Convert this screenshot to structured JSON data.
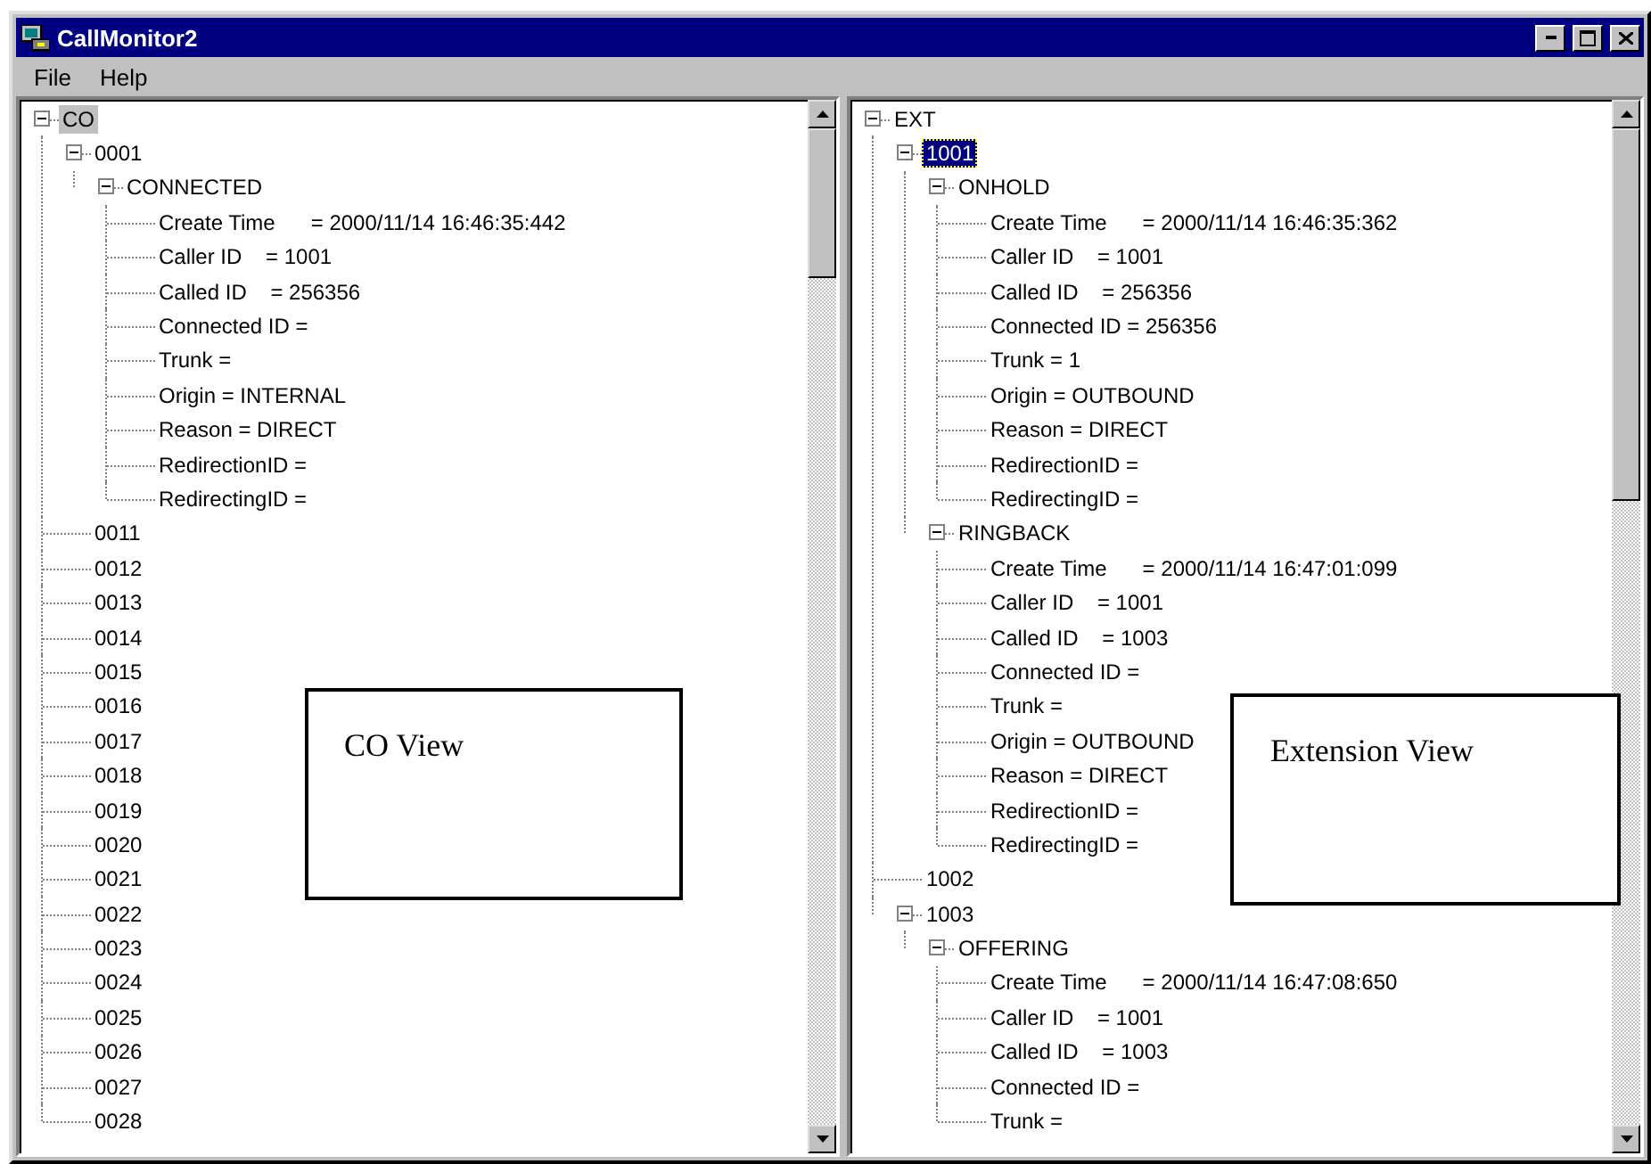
{
  "window": {
    "title": "CallMonitor2"
  },
  "menu": [
    {
      "label": "File"
    },
    {
      "label": "Help"
    }
  ],
  "panels": [
    {
      "focused": false,
      "annotation": "CO View",
      "tree": [
        {
          "label": "CO",
          "selected": true,
          "expanded": true,
          "children": [
            {
              "label": "0001",
              "selected": false,
              "expanded": true,
              "children": [
                {
                  "label": "CONNECTED",
                  "selected": false,
                  "expanded": true,
                  "children": [
                    {
                      "label": "Create Time      = 2000/11/14 16:46:35:442",
                      "selected": false
                    },
                    {
                      "label": "Caller ID    = 1001",
                      "selected": false
                    },
                    {
                      "label": "Called ID    = 256356",
                      "selected": false
                    },
                    {
                      "label": "Connected ID =",
                      "selected": false
                    },
                    {
                      "label": "Trunk =",
                      "selected": false
                    },
                    {
                      "label": "Origin = INTERNAL",
                      "selected": false
                    },
                    {
                      "label": "Reason = DIRECT",
                      "selected": false
                    },
                    {
                      "label": "RedirectionID =",
                      "selected": false
                    },
                    {
                      "label": "RedirectingID =",
                      "selected": false
                    }
                  ]
                }
              ]
            },
            {
              "label": "0011",
              "selected": false
            },
            {
              "label": "0012",
              "selected": false
            },
            {
              "label": "0013",
              "selected": false
            },
            {
              "label": "0014",
              "selected": false
            },
            {
              "label": "0015",
              "selected": false
            },
            {
              "label": "0016",
              "selected": false
            },
            {
              "label": "0017",
              "selected": false
            },
            {
              "label": "0018",
              "selected": false
            },
            {
              "label": "0019",
              "selected": false
            },
            {
              "label": "0020",
              "selected": false
            },
            {
              "label": "0021",
              "selected": false
            },
            {
              "label": "0022",
              "selected": false
            },
            {
              "label": "0023",
              "selected": false
            },
            {
              "label": "0024",
              "selected": false
            },
            {
              "label": "0025",
              "selected": false
            },
            {
              "label": "0026",
              "selected": false
            },
            {
              "label": "0027",
              "selected": false
            },
            {
              "label": "0028",
              "selected": false
            }
          ]
        }
      ]
    },
    {
      "focused": true,
      "annotation": "Extension View",
      "tree": [
        {
          "label": "EXT",
          "selected": false,
          "expanded": true,
          "children": [
            {
              "label": "1001",
              "selected": true,
              "expanded": true,
              "children": [
                {
                  "label": "ONHOLD",
                  "selected": false,
                  "expanded": true,
                  "children": [
                    {
                      "label": "Create Time      = 2000/11/14 16:46:35:362",
                      "selected": false
                    },
                    {
                      "label": "Caller ID    = 1001",
                      "selected": false
                    },
                    {
                      "label": "Called ID    = 256356",
                      "selected": false
                    },
                    {
                      "label": "Connected ID = 256356",
                      "selected": false
                    },
                    {
                      "label": "Trunk = 1",
                      "selected": false
                    },
                    {
                      "label": "Origin = OUTBOUND",
                      "selected": false
                    },
                    {
                      "label": "Reason = DIRECT",
                      "selected": false
                    },
                    {
                      "label": "RedirectionID =",
                      "selected": false
                    },
                    {
                      "label": "RedirectingID =",
                      "selected": false
                    }
                  ]
                },
                {
                  "label": "RINGBACK",
                  "selected": false,
                  "expanded": true,
                  "children": [
                    {
                      "label": "Create Time      = 2000/11/14 16:47:01:099",
                      "selected": false
                    },
                    {
                      "label": "Caller ID    = 1001",
                      "selected": false
                    },
                    {
                      "label": "Called ID    = 1003",
                      "selected": false
                    },
                    {
                      "label": "Connected ID =",
                      "selected": false
                    },
                    {
                      "label": "Trunk =",
                      "selected": false
                    },
                    {
                      "label": "Origin = OUTBOUND",
                      "selected": false
                    },
                    {
                      "label": "Reason = DIRECT",
                      "selected": false
                    },
                    {
                      "label": "RedirectionID =",
                      "selected": false
                    },
                    {
                      "label": "RedirectingID =",
                      "selected": false
                    }
                  ]
                }
              ]
            },
            {
              "label": "1002",
              "selected": false
            },
            {
              "label": "1003",
              "selected": false,
              "expanded": true,
              "children": [
                {
                  "label": "OFFERING",
                  "selected": false,
                  "expanded": true,
                  "children": [
                    {
                      "label": "Create Time      = 2000/11/14 16:47:08:650",
                      "selected": false
                    },
                    {
                      "label": "Caller ID    = 1001",
                      "selected": false
                    },
                    {
                      "label": "Called ID    = 1003",
                      "selected": false
                    },
                    {
                      "label": "Connected ID =",
                      "selected": false
                    },
                    {
                      "label": "Trunk =",
                      "selected": false
                    }
                  ]
                }
              ]
            }
          ]
        }
      ]
    }
  ]
}
